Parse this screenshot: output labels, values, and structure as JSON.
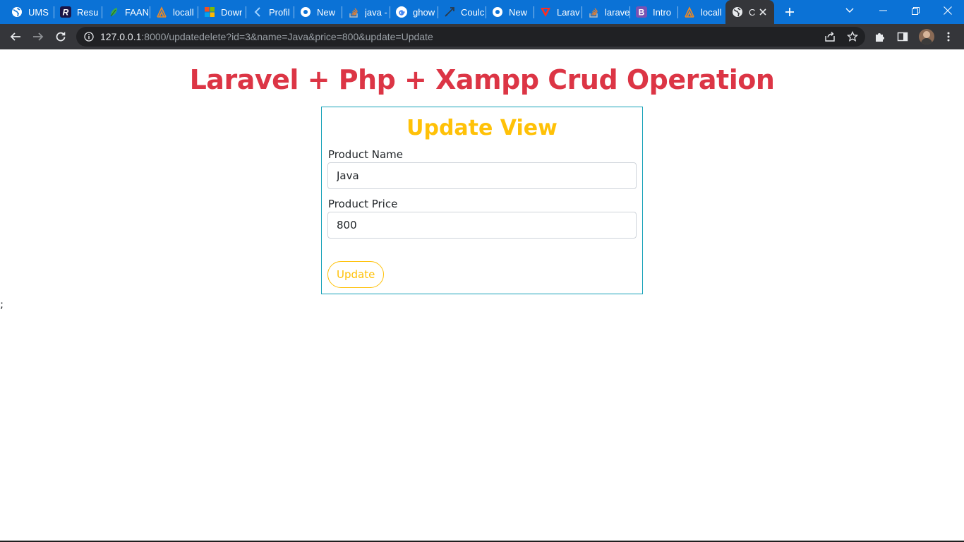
{
  "browser": {
    "tabs": [
      {
        "title": "UMS",
        "icon": "globe-icon"
      },
      {
        "title": "Resu",
        "icon": "resume-r-icon"
      },
      {
        "title": "FAAN",
        "icon": "leaf-icon"
      },
      {
        "title": "locall",
        "icon": "xampp-icon"
      },
      {
        "title": "Dowr",
        "icon": "windows-logo-icon"
      },
      {
        "title": "Profil",
        "icon": "bracket-c-icon"
      },
      {
        "title": "New",
        "icon": "chrome-icon"
      },
      {
        "title": "java -",
        "icon": "stackoverflow-icon"
      },
      {
        "title": "ghow",
        "icon": "google-g-icon"
      },
      {
        "title": "Coulc",
        "icon": "arrow-feather-icon"
      },
      {
        "title": "New",
        "icon": "chrome-icon"
      },
      {
        "title": "Larav",
        "icon": "laravel-icon"
      },
      {
        "title": "larave",
        "icon": "stackoverflow-icon"
      },
      {
        "title": "Intro",
        "icon": "bootstrap-b-icon"
      },
      {
        "title": "locall",
        "icon": "xampp-icon"
      }
    ],
    "active_tab": {
      "title": "C",
      "icon": "globe-icon"
    },
    "url_host": "127.0.0.1",
    "url_rest": ":8000/updatedelete?id=3&name=Java&price=800&update=Update",
    "colors": {
      "tabstrip": "#0b72d6",
      "toolbar": "#35363a"
    }
  },
  "page": {
    "title": "Laravel + Php + Xampp Crud Operation",
    "card_title": "Update View",
    "name_label": "Product Name",
    "name_value": "Java",
    "price_label": "Product Price",
    "price_value": "800",
    "button_label": "Update",
    "stray_text": ";",
    "colors": {
      "title": "#dc3545",
      "card_title": "#ffc107",
      "card_border": "#17a2b8",
      "button": "#ffc107"
    }
  }
}
